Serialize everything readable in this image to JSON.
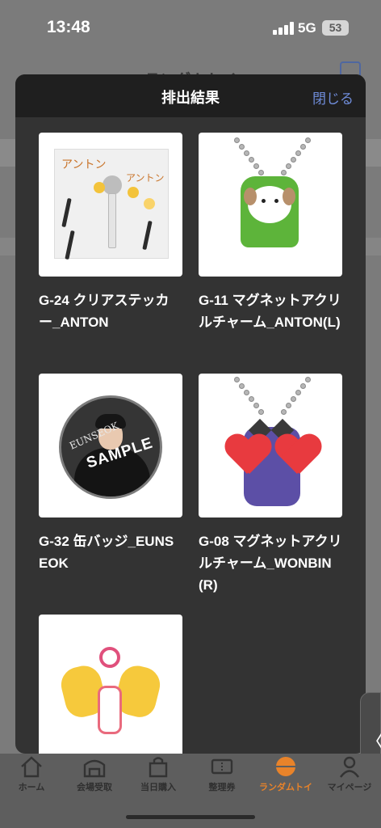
{
  "status_bar": {
    "time": "13:48",
    "network": "5G",
    "battery": "53"
  },
  "background_screen": {
    "title": "ランダムトイ"
  },
  "modal": {
    "title": "排出結果",
    "close_label": "閉じる",
    "items": [
      {
        "label": "G-24 クリアステッカー_ANTON",
        "art": "clear-sticker",
        "sticker_text": "アントン"
      },
      {
        "label": "G-11 マグネットアクリルチャーム_ANTON(L)",
        "art": "acrylic-charm-dog"
      },
      {
        "label": "G-32 缶バッジ_EUNSEOK",
        "art": "can-badge",
        "badge_text": "SAMPLE",
        "badge_signature": "EUNSEOK"
      },
      {
        "label": "G-08 マグネットアクリルチャーム_WONBIN(R)",
        "art": "acrylic-charm-hearts"
      },
      {
        "label": "",
        "art": "keyring-hands"
      }
    ]
  },
  "bottom_nav": {
    "items": [
      {
        "label": "ホーム",
        "icon": "home-icon"
      },
      {
        "label": "会場受取",
        "icon": "venue-icon"
      },
      {
        "label": "当日購入",
        "icon": "shopping-bag-icon"
      },
      {
        "label": "整理券",
        "icon": "ticket-icon"
      },
      {
        "label": "ランダムトイ",
        "icon": "random-toy-icon",
        "active": true
      },
      {
        "label": "マイページ",
        "icon": "user-icon"
      }
    ]
  },
  "side_tab": {
    "glyph": "〈"
  },
  "colors": {
    "accent_link": "#6f8cd9",
    "active_nav": "#e8832a",
    "modal_bg": "#333333"
  }
}
